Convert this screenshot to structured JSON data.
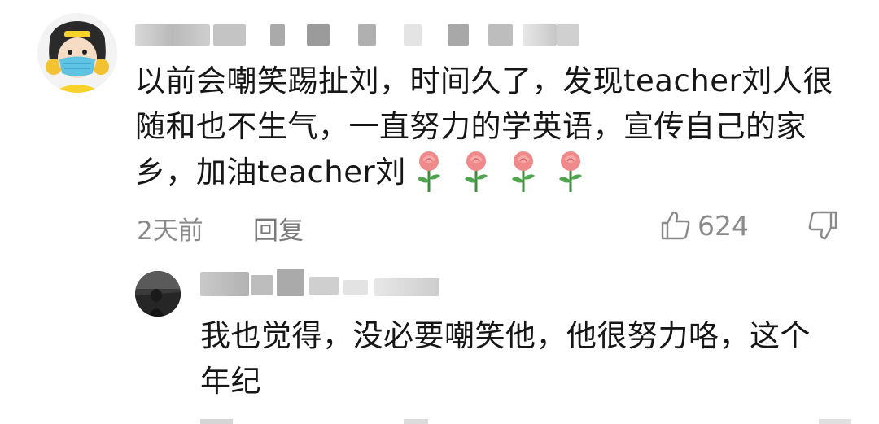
{
  "comment": {
    "username": "",
    "text": "以前会嘲笑踢扯刘，时间久了，发现teacher刘人很随和也不生气，一直努力的学英语，宣传自己的家乡，加油teacher刘",
    "emoji": [
      "rose",
      "rose",
      "rose",
      "rose"
    ],
    "time": "2天前",
    "reply_label": "回复",
    "like_count": "624"
  },
  "reply": {
    "username": "",
    "text": "我也觉得，没必要嘲笑他，他很努力咯，这个年纪"
  },
  "colors": {
    "text": "#161616",
    "meta": "#8a8a8a",
    "background": "#ffffff",
    "mask_blue": "#5fc3e4",
    "hat_yellow": "#f7d32a",
    "rose_petal": "#f08a8a",
    "rose_stem": "#3e8e3e"
  },
  "icons": {
    "like": "thumbs-up-icon",
    "dislike": "thumbs-down-icon"
  }
}
